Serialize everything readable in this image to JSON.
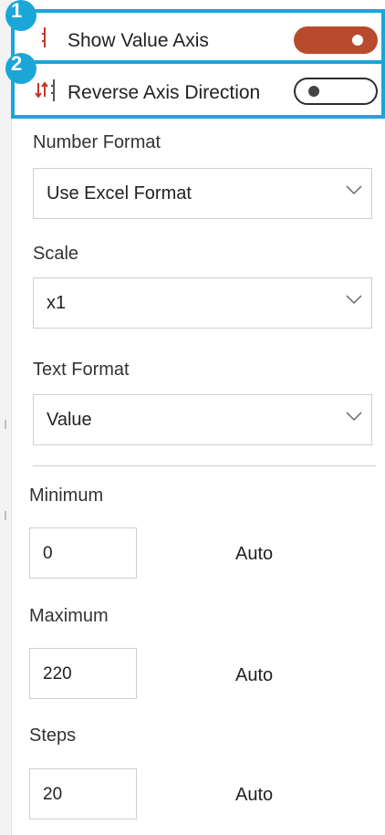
{
  "highlights": [
    {
      "badge": "1",
      "label": "Show Value Axis",
      "icon": "vertical-axis-icon",
      "toggle_on": true
    },
    {
      "badge": "2",
      "label": "Reverse Axis Direction",
      "icon": "reverse-axis-icon",
      "toggle_on": false
    }
  ],
  "number_format": {
    "label": "Number Format",
    "value": "Use Excel Format"
  },
  "scale": {
    "label": "Scale",
    "value": "x1"
  },
  "text_format": {
    "label": "Text Format",
    "value": "Value"
  },
  "minimum": {
    "label": "Minimum",
    "value": "0",
    "auto_label": "Auto"
  },
  "maximum": {
    "label": "Maximum",
    "value": "220",
    "auto_label": "Auto"
  },
  "steps": {
    "label": "Steps",
    "value": "20",
    "auto_label": "Auto"
  },
  "colors": {
    "highlight": "#1aa7d8",
    "toggle_on": "#b84a2d",
    "border": "#cfcfcf"
  }
}
